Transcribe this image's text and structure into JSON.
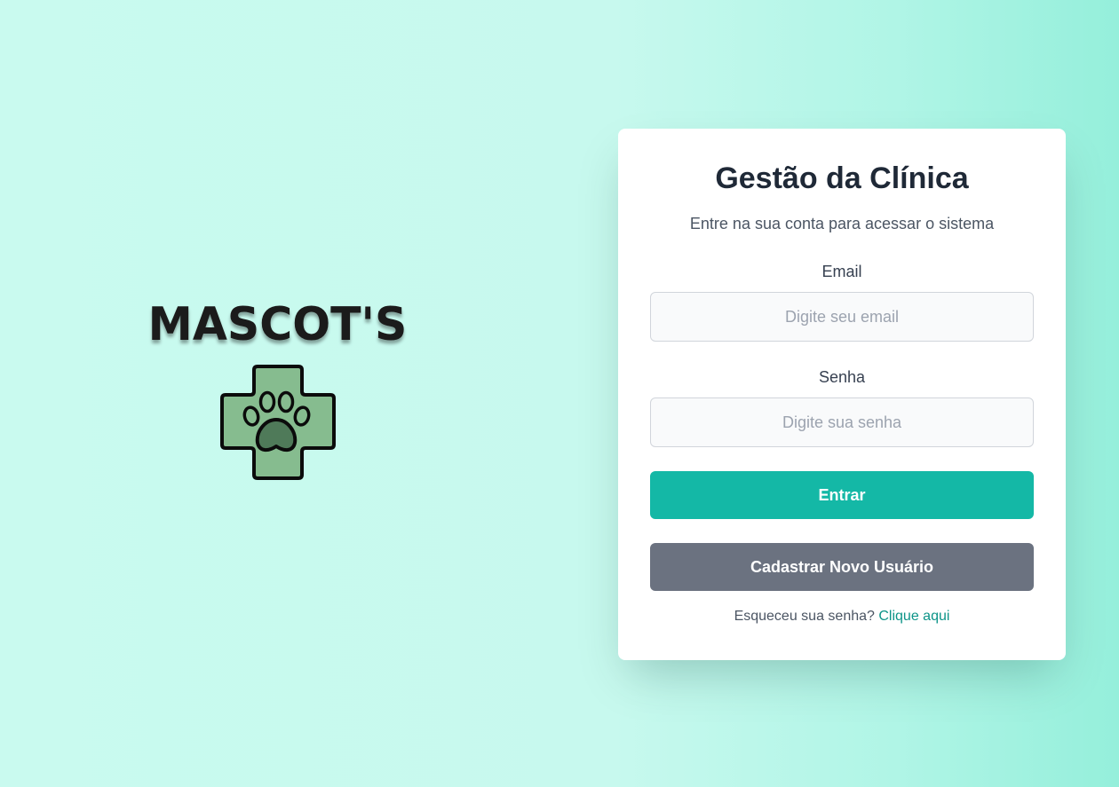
{
  "brand": {
    "name": "MASCOT'S",
    "logo_icon": "paw-cross-icon",
    "logo_colors": {
      "cross_fill": "#86bc8f",
      "paw_fill": "#4f7a59",
      "outline": "#0b0b0b"
    }
  },
  "login_card": {
    "title": "Gestão da Clínica",
    "subtitle": "Entre na sua conta para acessar o sistema",
    "email": {
      "label": "Email",
      "placeholder": "Digite seu email",
      "value": ""
    },
    "password": {
      "label": "Senha",
      "placeholder": "Digite sua senha",
      "value": ""
    },
    "login_button": "Entrar",
    "register_button": "Cadastrar Novo Usuário",
    "forgot_text": "Esqueceu sua senha?",
    "forgot_link": "Clique aqui"
  },
  "colors": {
    "primary": "#14b8a6",
    "secondary": "#6b7280",
    "link": "#0d9488",
    "background": "#c7f9ee"
  }
}
